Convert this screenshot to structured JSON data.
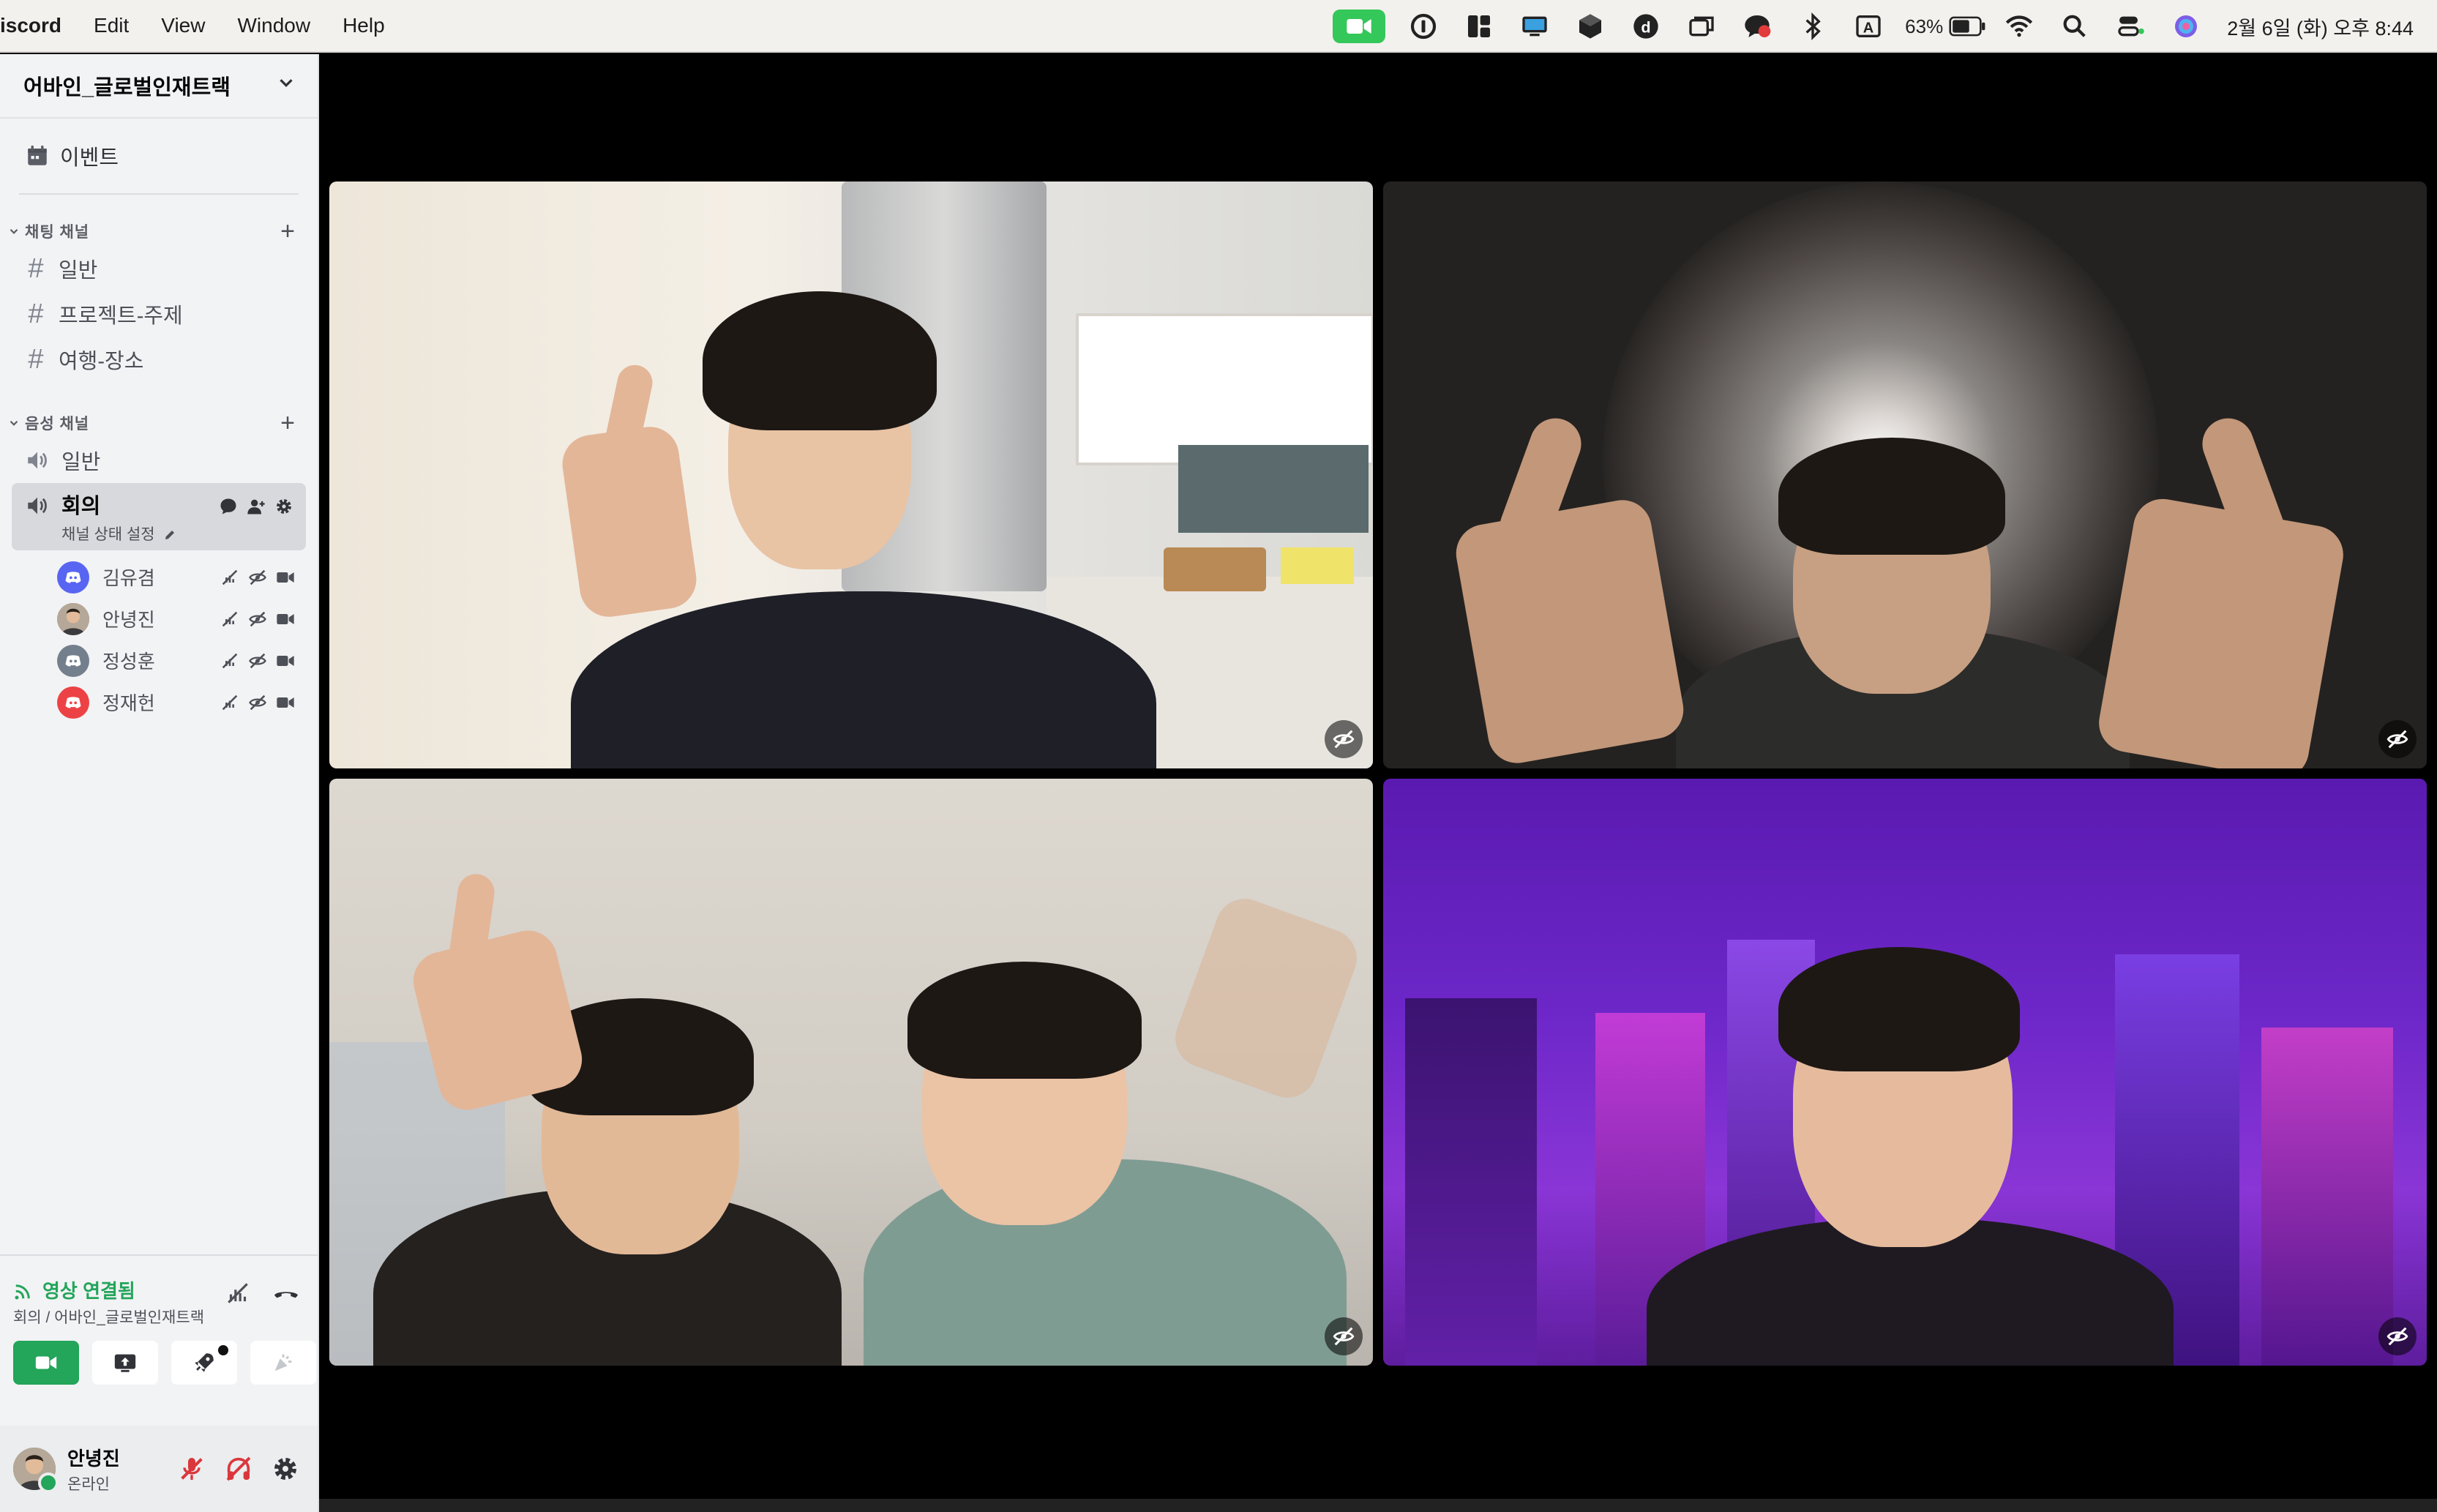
{
  "menubar": {
    "app_name": "iscord",
    "menus": [
      "Edit",
      "View",
      "Window",
      "Help"
    ],
    "battery": "63%",
    "clock": "2월 6일 (화) 오후 8:44",
    "status_icons": [
      "video-camera-icon",
      "one-password-icon",
      "layout-icon",
      "display-icon",
      "cube-icon",
      "d-app-icon",
      "windows-icon",
      "chat-badge-icon",
      "bluetooth-icon",
      "input-source-icon",
      "battery-icon",
      "wifi-icon",
      "spotlight-search-icon",
      "control-center-icon",
      "siri-icon"
    ],
    "input_source": "A"
  },
  "server": {
    "name": "어바인_글로벌인재트랙",
    "events_label": "이벤트"
  },
  "text_category": {
    "label": "채팅 채널",
    "channels": [
      "일반",
      "프로젝트-주제",
      "여행-장소"
    ]
  },
  "voice_category": {
    "label": "음성 채널",
    "channels": [
      "일반"
    ],
    "active_channel": {
      "name": "회의",
      "status_label": "채널 상태 설정"
    },
    "members": [
      {
        "name": "김유겸",
        "avatar_color": "#5865f2"
      },
      {
        "name": "안녕진",
        "avatar_color": "#8a7462"
      },
      {
        "name": "정성훈",
        "avatar_color": "#747f8d"
      },
      {
        "name": "정재헌",
        "avatar_color": "#ed4245"
      }
    ]
  },
  "rtc": {
    "status": "영상 연결됨",
    "location": "회의 / 어바인_글로벌인재트랙"
  },
  "user": {
    "name": "안녕진",
    "status": "온라인"
  },
  "colors": {
    "accent_green": "#23a55a",
    "blurple": "#5865f2",
    "danger_red": "#da373c"
  }
}
